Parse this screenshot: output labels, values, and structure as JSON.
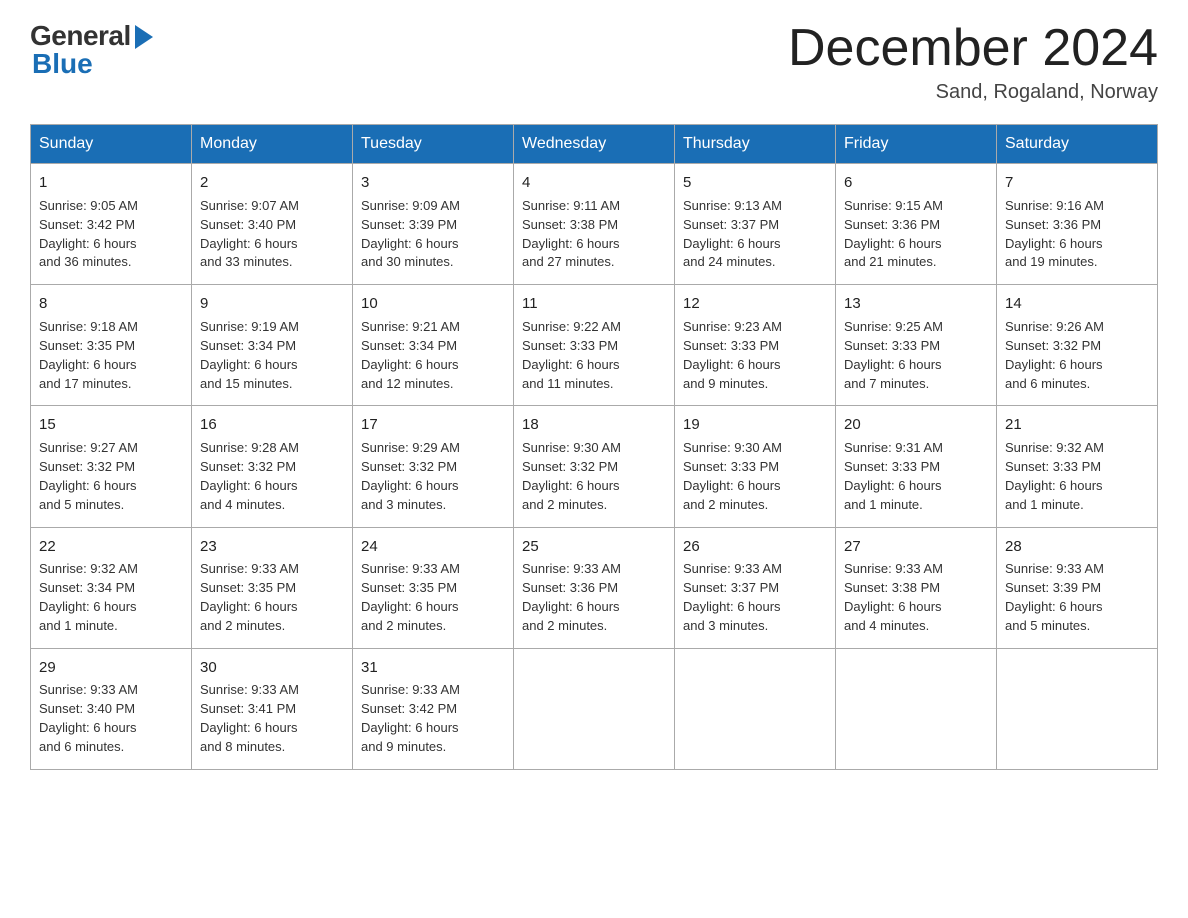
{
  "logo": {
    "general": "General",
    "blue": "Blue"
  },
  "header": {
    "month_title": "December 2024",
    "location": "Sand, Rogaland, Norway"
  },
  "weekdays": [
    "Sunday",
    "Monday",
    "Tuesday",
    "Wednesday",
    "Thursday",
    "Friday",
    "Saturday"
  ],
  "weeks": [
    [
      {
        "day": "1",
        "sunrise": "9:05 AM",
        "sunset": "3:42 PM",
        "daylight": "6 hours and 36 minutes."
      },
      {
        "day": "2",
        "sunrise": "9:07 AM",
        "sunset": "3:40 PM",
        "daylight": "6 hours and 33 minutes."
      },
      {
        "day": "3",
        "sunrise": "9:09 AM",
        "sunset": "3:39 PM",
        "daylight": "6 hours and 30 minutes."
      },
      {
        "day": "4",
        "sunrise": "9:11 AM",
        "sunset": "3:38 PM",
        "daylight": "6 hours and 27 minutes."
      },
      {
        "day": "5",
        "sunrise": "9:13 AM",
        "sunset": "3:37 PM",
        "daylight": "6 hours and 24 minutes."
      },
      {
        "day": "6",
        "sunrise": "9:15 AM",
        "sunset": "3:36 PM",
        "daylight": "6 hours and 21 minutes."
      },
      {
        "day": "7",
        "sunrise": "9:16 AM",
        "sunset": "3:36 PM",
        "daylight": "6 hours and 19 minutes."
      }
    ],
    [
      {
        "day": "8",
        "sunrise": "9:18 AM",
        "sunset": "3:35 PM",
        "daylight": "6 hours and 17 minutes."
      },
      {
        "day": "9",
        "sunrise": "9:19 AM",
        "sunset": "3:34 PM",
        "daylight": "6 hours and 15 minutes."
      },
      {
        "day": "10",
        "sunrise": "9:21 AM",
        "sunset": "3:34 PM",
        "daylight": "6 hours and 12 minutes."
      },
      {
        "day": "11",
        "sunrise": "9:22 AM",
        "sunset": "3:33 PM",
        "daylight": "6 hours and 11 minutes."
      },
      {
        "day": "12",
        "sunrise": "9:23 AM",
        "sunset": "3:33 PM",
        "daylight": "6 hours and 9 minutes."
      },
      {
        "day": "13",
        "sunrise": "9:25 AM",
        "sunset": "3:33 PM",
        "daylight": "6 hours and 7 minutes."
      },
      {
        "day": "14",
        "sunrise": "9:26 AM",
        "sunset": "3:32 PM",
        "daylight": "6 hours and 6 minutes."
      }
    ],
    [
      {
        "day": "15",
        "sunrise": "9:27 AM",
        "sunset": "3:32 PM",
        "daylight": "6 hours and 5 minutes."
      },
      {
        "day": "16",
        "sunrise": "9:28 AM",
        "sunset": "3:32 PM",
        "daylight": "6 hours and 4 minutes."
      },
      {
        "day": "17",
        "sunrise": "9:29 AM",
        "sunset": "3:32 PM",
        "daylight": "6 hours and 3 minutes."
      },
      {
        "day": "18",
        "sunrise": "9:30 AM",
        "sunset": "3:32 PM",
        "daylight": "6 hours and 2 minutes."
      },
      {
        "day": "19",
        "sunrise": "9:30 AM",
        "sunset": "3:33 PM",
        "daylight": "6 hours and 2 minutes."
      },
      {
        "day": "20",
        "sunrise": "9:31 AM",
        "sunset": "3:33 PM",
        "daylight": "6 hours and 1 minute."
      },
      {
        "day": "21",
        "sunrise": "9:32 AM",
        "sunset": "3:33 PM",
        "daylight": "6 hours and 1 minute."
      }
    ],
    [
      {
        "day": "22",
        "sunrise": "9:32 AM",
        "sunset": "3:34 PM",
        "daylight": "6 hours and 1 minute."
      },
      {
        "day": "23",
        "sunrise": "9:33 AM",
        "sunset": "3:35 PM",
        "daylight": "6 hours and 2 minutes."
      },
      {
        "day": "24",
        "sunrise": "9:33 AM",
        "sunset": "3:35 PM",
        "daylight": "6 hours and 2 minutes."
      },
      {
        "day": "25",
        "sunrise": "9:33 AM",
        "sunset": "3:36 PM",
        "daylight": "6 hours and 2 minutes."
      },
      {
        "day": "26",
        "sunrise": "9:33 AM",
        "sunset": "3:37 PM",
        "daylight": "6 hours and 3 minutes."
      },
      {
        "day": "27",
        "sunrise": "9:33 AM",
        "sunset": "3:38 PM",
        "daylight": "6 hours and 4 minutes."
      },
      {
        "day": "28",
        "sunrise": "9:33 AM",
        "sunset": "3:39 PM",
        "daylight": "6 hours and 5 minutes."
      }
    ],
    [
      {
        "day": "29",
        "sunrise": "9:33 AM",
        "sunset": "3:40 PM",
        "daylight": "6 hours and 6 minutes."
      },
      {
        "day": "30",
        "sunrise": "9:33 AM",
        "sunset": "3:41 PM",
        "daylight": "6 hours and 8 minutes."
      },
      {
        "day": "31",
        "sunrise": "9:33 AM",
        "sunset": "3:42 PM",
        "daylight": "6 hours and 9 minutes."
      },
      null,
      null,
      null,
      null
    ]
  ],
  "labels": {
    "sunrise": "Sunrise:",
    "sunset": "Sunset:",
    "daylight": "Daylight:"
  }
}
